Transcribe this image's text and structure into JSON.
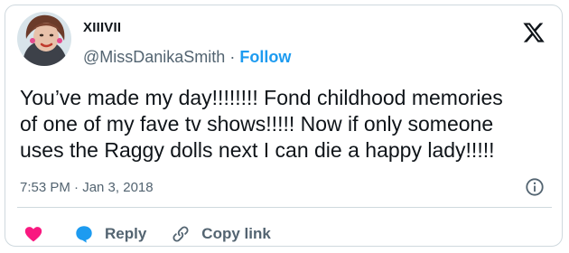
{
  "author": {
    "display_name": "XIIIVII",
    "handle": "@MissDanikaSmith",
    "separator": "·",
    "follow_label": "Follow"
  },
  "tweet": {
    "text": "You’ve made my day!!!!!!!! Fond childhood memories\nof one of my fave tv shows!!!!! Now if only someone\nuses the Raggy dolls next I can die a happy lady!!!!!",
    "timestamp": "7:53 PM · Jan 3, 2018"
  },
  "actions": {
    "reply_label": "Reply",
    "copy_link_label": "Copy link"
  },
  "icons": {
    "logo": "x-logo-icon",
    "info": "info-icon",
    "like": "heart-icon",
    "reply": "speech-bubble-icon",
    "copy": "link-icon"
  },
  "colors": {
    "accent": "#1d9bf0",
    "like": "#f91880",
    "text": "#0f1419",
    "muted": "#536471",
    "border": "#cfd9de"
  }
}
